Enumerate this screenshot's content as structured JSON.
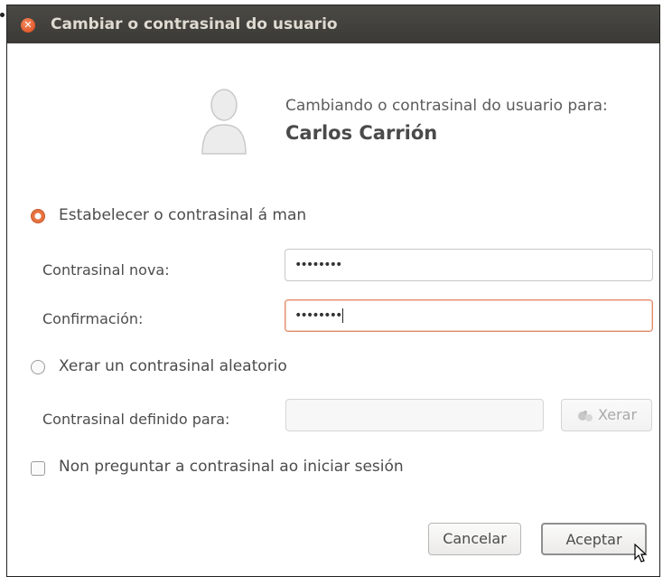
{
  "dialog": {
    "title": "Cambiar o contrasinal do usuario",
    "heading": "Cambiando o contrasinal do usuario para:",
    "user_name": "Carlos Carrión"
  },
  "options": {
    "manual_label": "Estabelecer o contrasinal á man",
    "random_label": "Xerar un contrasinal aleatorio",
    "no_ask_label": "Non preguntar a contrasinal ao iniciar sesión"
  },
  "fields": {
    "new_password_label": "Contrasinal nova:",
    "new_password_value": "••••••••",
    "confirm_label": "Confirmación:",
    "confirm_value": "••••••••",
    "defined_label": "Contrasinal definido para:",
    "defined_value": ""
  },
  "buttons": {
    "generate": "Xerar",
    "cancel": "Cancelar",
    "accept": "Aceptar"
  },
  "colors": {
    "accent": "#e7723e",
    "titlebar": "#3b3a36"
  }
}
